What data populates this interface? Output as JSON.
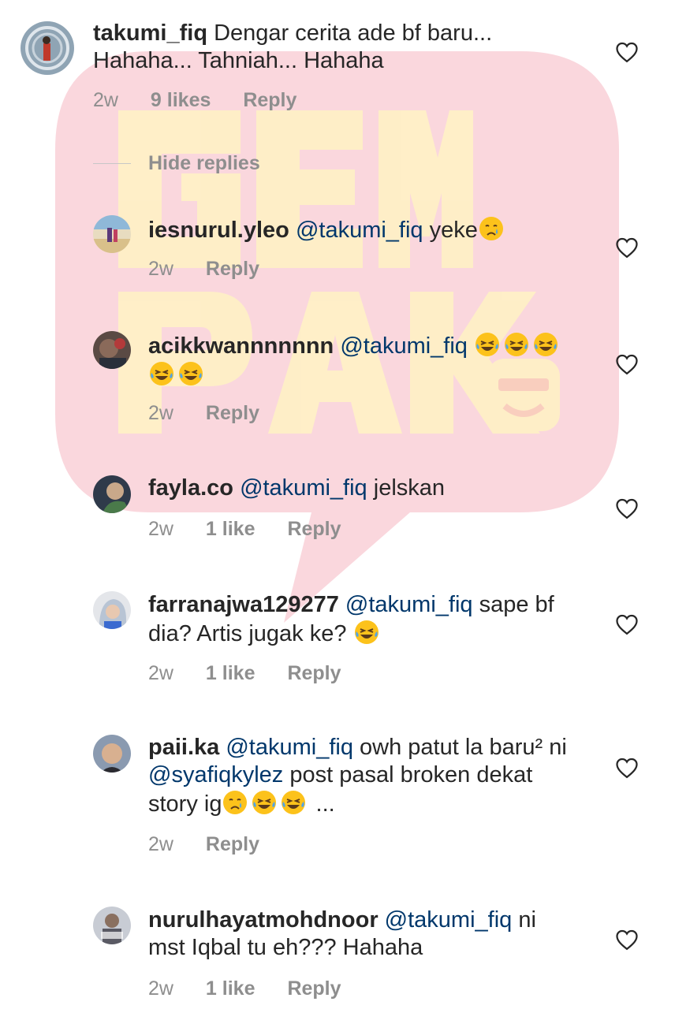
{
  "watermark": {
    "line1": "GEM",
    "line2": "PAK",
    "colors": {
      "bubble": "#f4a7b3",
      "letters": "#fff3c4"
    }
  },
  "hide_replies": "Hide replies",
  "comments": [
    {
      "username": "takumi_fiq",
      "text": "Dengar cerita ade bf baru... Hahaha... Tahniah... Hahaha",
      "time": "2w",
      "likes": "9 likes",
      "reply": "Reply"
    },
    {
      "username": "iesnurul.yleo",
      "mention": "@takumi_fiq",
      "text": "yeke",
      "emojis": [
        "crying-face"
      ],
      "time": "2w",
      "reply": "Reply"
    },
    {
      "username": "acikkwannnnnnn",
      "mention": "@takumi_fiq",
      "emojis": [
        "tears-of-joy",
        "tears-of-joy",
        "tears-of-joy",
        "tears-of-joy",
        "tears-of-joy"
      ],
      "time": "2w",
      "reply": "Reply"
    },
    {
      "username": "fayla.co",
      "mention": "@takumi_fiq",
      "text": "jelskan",
      "time": "2w",
      "likes": "1 like",
      "reply": "Reply"
    },
    {
      "username": "farranajwa129277",
      "mention": "@takumi_fiq",
      "text": "sape bf dia? Artis jugak ke?",
      "emojis": [
        "tears-of-joy"
      ],
      "time": "2w",
      "likes": "1 like",
      "reply": "Reply"
    },
    {
      "username": "paii.ka",
      "mention": "@takumi_fiq",
      "text": "owh patut la baru² ni",
      "mention2": "@syafiqkylez",
      "text2": "post pasal broken dekat story ig",
      "emojis": [
        "crying-face",
        "tears-of-joy",
        "tears-of-joy"
      ],
      "text3": "...",
      "time": "2w",
      "reply": "Reply"
    },
    {
      "username": "nurulhayatmohdnoor",
      "mention": "@takumi_fiq",
      "text": "ni mst Iqbal tu eh??? Hahaha",
      "time": "2w",
      "likes": "1 like",
      "reply": "Reply"
    }
  ]
}
